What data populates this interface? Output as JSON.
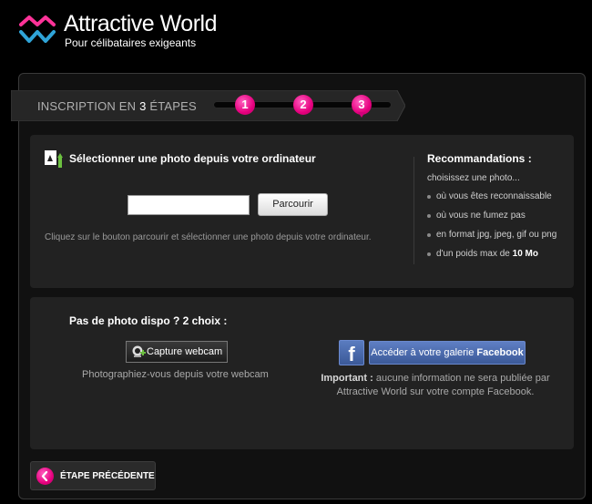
{
  "brand": {
    "name": "Attractive World",
    "tagline": "Pour célibataires exigeants",
    "colors": {
      "accent": "#e6007e",
      "logo_blue": "#2fa4d8",
      "logo_pink": "#ff3399"
    }
  },
  "steps": {
    "label_prefix": "INSCRIPTION EN ",
    "label_count": "3",
    "label_suffix": " ÉTAPES",
    "items": [
      "1",
      "2",
      "3"
    ],
    "current": 3
  },
  "upload": {
    "title": "Sélectionner une photo depuis votre ordinateur",
    "file_value": "",
    "browse_label": "Parcourir",
    "hint": "Cliquez sur le bouton parcourir et sélectionner une photo depuis votre ordinateur.",
    "icon": "upload-photo-icon"
  },
  "recommendations": {
    "title": "Recommandations :",
    "intro": "choisissez une photo...",
    "items": [
      "où vous êtes reconnaissable",
      "où vous ne fumez pas",
      "en format jpg, jpeg, gif ou png",
      "d'un poids max de "
    ],
    "size_limit": "10 Mo"
  },
  "no_photo": {
    "title": "Pas de photo dispo ? 2 choix :",
    "webcam_label": "Capture webcam",
    "webcam_caption": "Photographiez-vous depuis votre webcam",
    "facebook_prefix": "Accéder à votre galerie ",
    "facebook_name": "Facebook",
    "facebook_icon_letter": "f",
    "note_important": "Important :",
    "note_text": " aucune information ne sera publiée par Attractive World sur votre compte Facebook.",
    "colors": {
      "facebook": "#3b5998"
    }
  },
  "navigation": {
    "previous_label": "ÉTAPE PRÉCÉDENTE"
  }
}
